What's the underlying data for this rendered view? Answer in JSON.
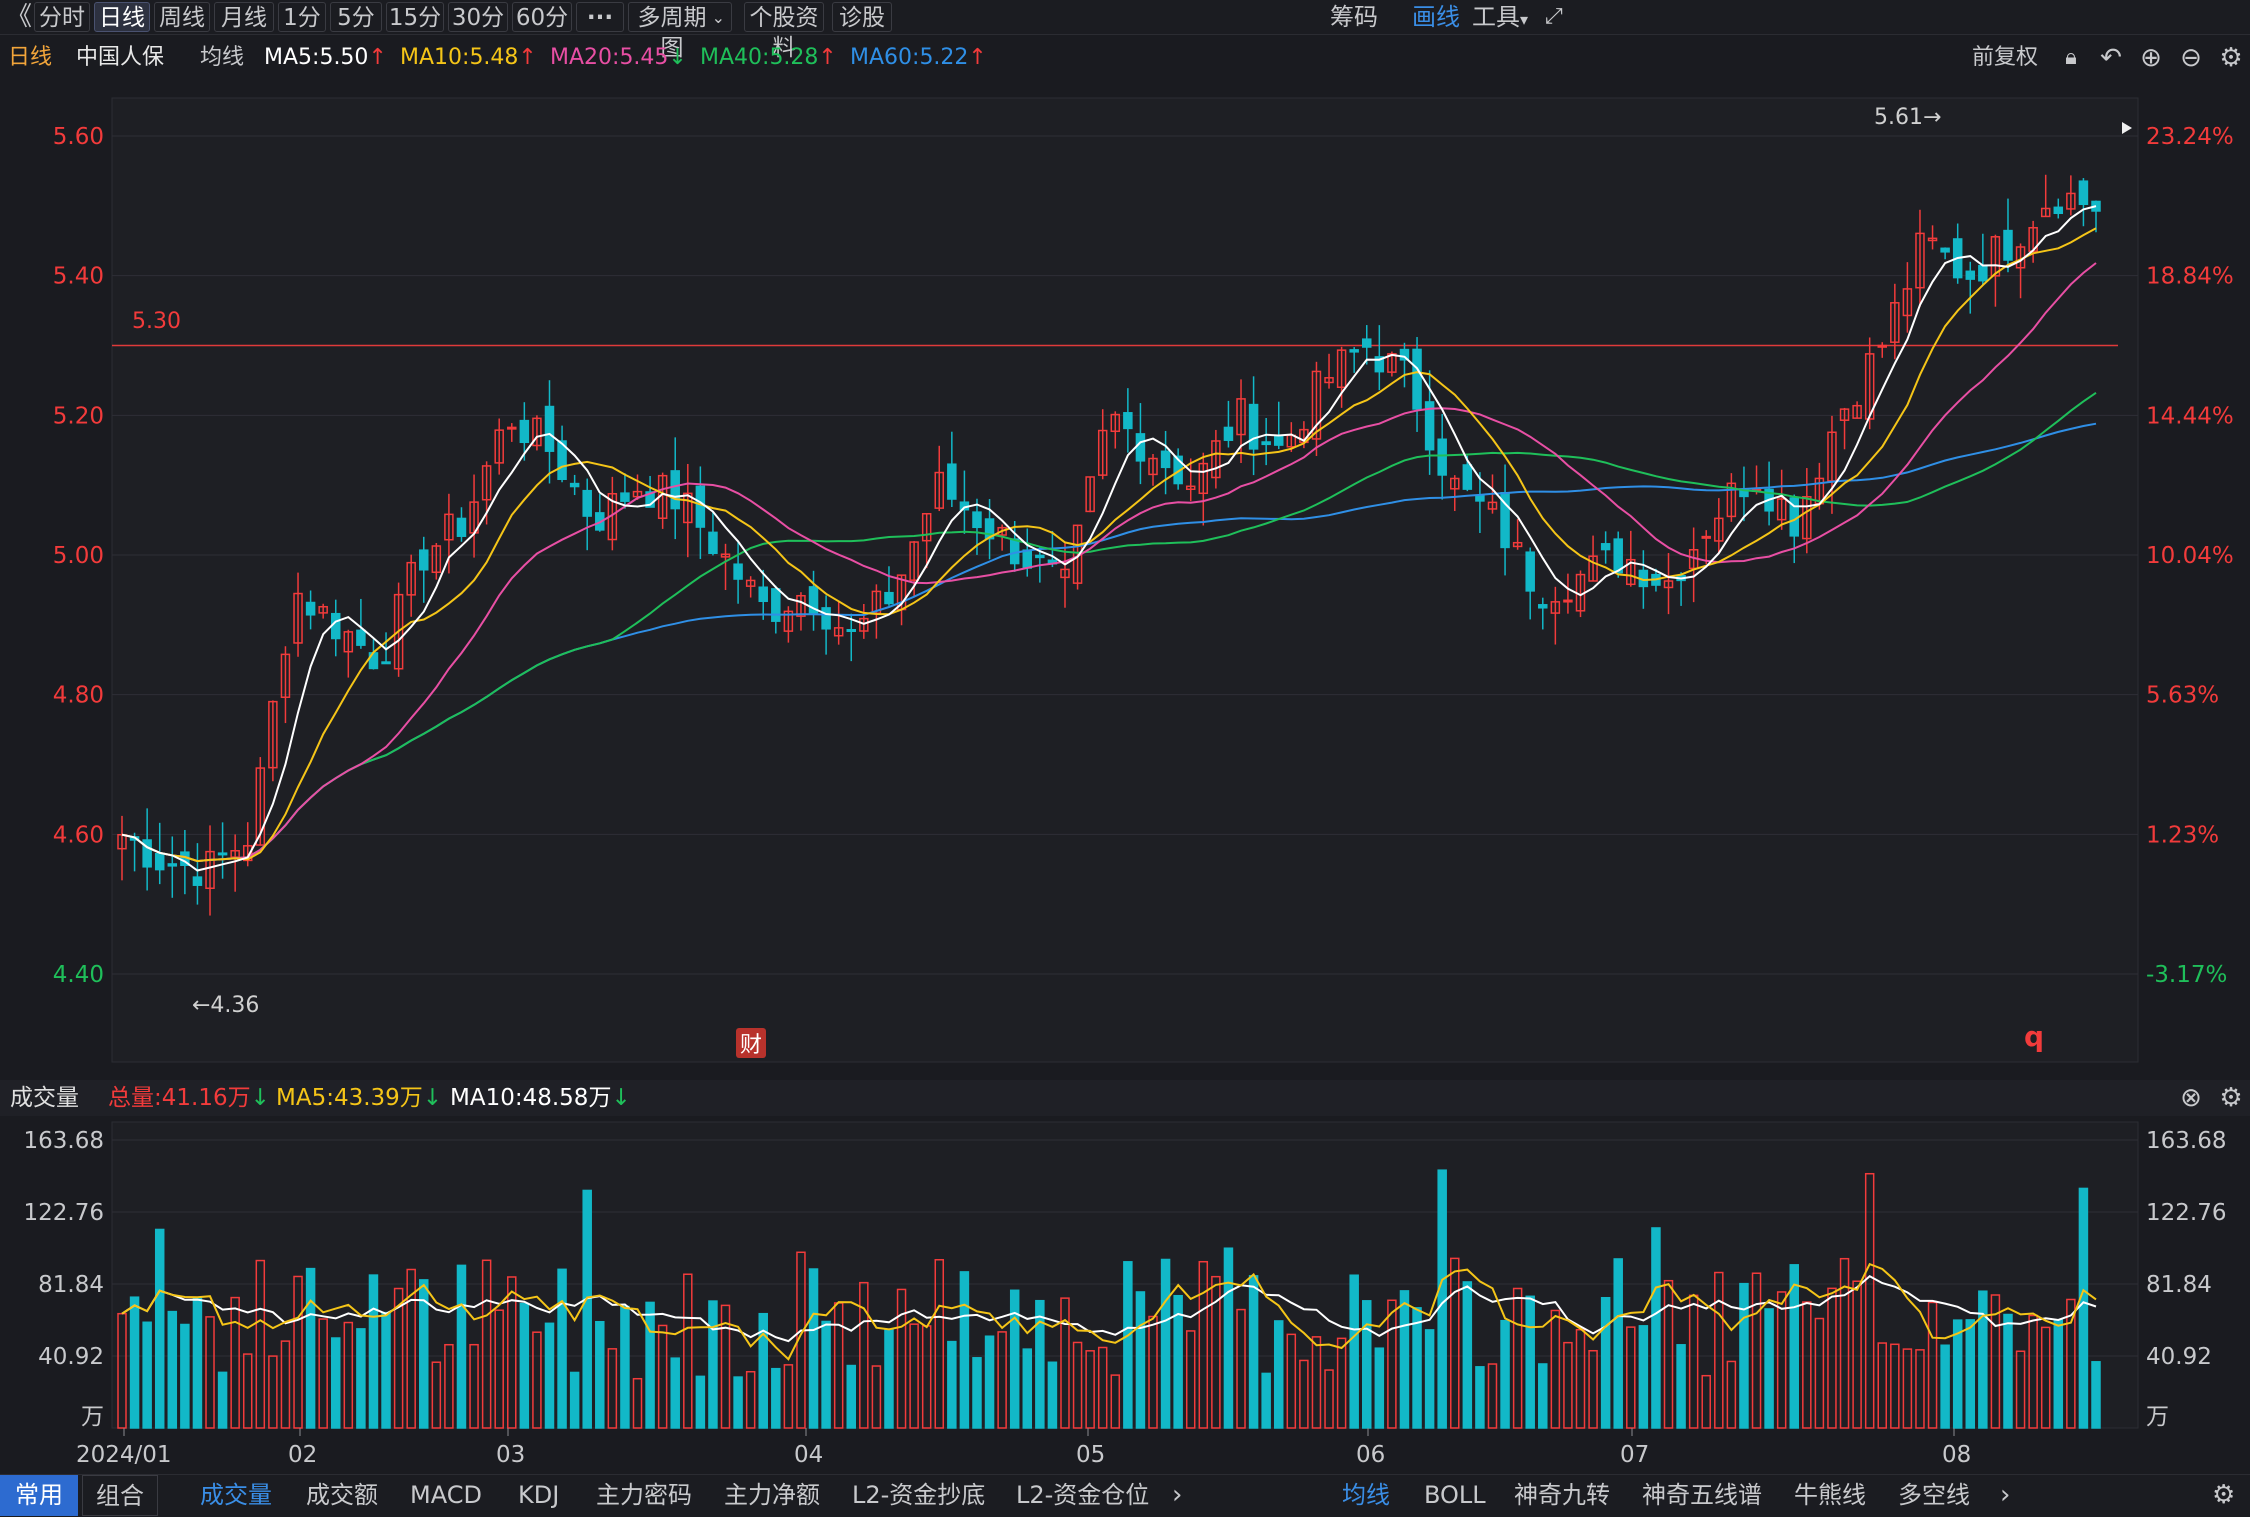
{
  "toolbar": {
    "back_icon": "chevron-left",
    "periods": [
      "分时",
      "日线",
      "周线",
      "月线",
      "1分",
      "5分",
      "15分",
      "30分",
      "60分"
    ],
    "active_period": "日线",
    "more": "···",
    "multi_period": "多周期图",
    "profile": "个股资料",
    "diagnose": "诊股",
    "chips": "筹码",
    "draw": "画线",
    "tools": "工具"
  },
  "header": {
    "period": "日线",
    "stock_name": "中国人保",
    "ma_label": "均线",
    "ma5": "MA5:5.50",
    "ma10": "MA10:5.48",
    "ma20": "MA20:5.45",
    "ma40": "MA40:5.28",
    "ma60": "MA60:5.22",
    "adjust": "前复权"
  },
  "colors": {
    "up": "#f23b3b",
    "down": "#12b8c8",
    "ma5": "#ffffff",
    "ma10": "#f5c518",
    "ma20": "#e84fa4",
    "ma40": "#1fbf5a",
    "ma60": "#2f8fe6",
    "accent": "#3a8ee6"
  },
  "price_axis": {
    "left_labels": [
      "5.60",
      "5.40",
      "5.20",
      "5.00",
      "4.80",
      "4.60",
      "4.40"
    ],
    "right_labels": [
      "23.24%",
      "18.84%",
      "14.44%",
      "10.04%",
      "5.63%",
      "1.23%",
      "-3.17%"
    ],
    "reference_line_label": "5.30",
    "high_marker": "5.61→",
    "low_marker": "←4.36",
    "finance_badge": "财",
    "q_marker": "q"
  },
  "volume": {
    "title": "成交量",
    "total": "总量:41.16万",
    "ma5": "MA5:43.39万",
    "ma10": "MA10:48.58万",
    "axis_labels": [
      "163.68",
      "122.76",
      "81.84",
      "40.92"
    ],
    "unit": "万"
  },
  "x_axis": {
    "labels": [
      "2024/01",
      "02",
      "03",
      "04",
      "05",
      "06",
      "07",
      "08"
    ]
  },
  "bottom_tabs": {
    "left": [
      "常用",
      "组合"
    ],
    "indicators": [
      "成交量",
      "成交额",
      "MACD",
      "KDJ",
      "主力密码",
      "主力净额",
      "L2-资金抄底",
      "L2-资金仓位"
    ],
    "overlays": [
      "均线",
      "BOLL",
      "神奇九转",
      "神奇五线谱",
      "牛熊线",
      "多空线"
    ]
  },
  "chart_data": {
    "type": "candlestick",
    "title": "中国人保 日线",
    "price_range": [
      4.36,
      5.61
    ],
    "reference_price": 5.3,
    "x_months": [
      "2024/01",
      "02",
      "03",
      "04",
      "05",
      "06",
      "07",
      "08"
    ],
    "close_anchors": [
      4.6,
      4.56,
      4.55,
      4.6,
      4.95,
      4.9,
      4.85,
      5.0,
      5.05,
      5.2,
      5.15,
      5.05,
      5.1,
      5.08,
      5.0,
      4.92,
      4.95,
      4.88,
      4.95,
      5.1,
      5.05,
      5.0,
      4.95,
      5.2,
      5.15,
      5.1,
      5.2,
      5.15,
      5.25,
      5.3,
      5.25,
      5.1,
      5.05,
      4.95,
      4.97,
      5.0,
      4.96,
      5.05,
      5.12,
      5.05,
      5.2,
      5.3,
      5.45,
      5.4,
      5.45,
      5.52,
      5.5
    ],
    "volume_range_wan": [
      0,
      163.68
    ],
    "volume_ma5_last_wan": 43.39,
    "volume_ma10_last_wan": 48.58,
    "volume_total_last_wan": 41.16
  }
}
